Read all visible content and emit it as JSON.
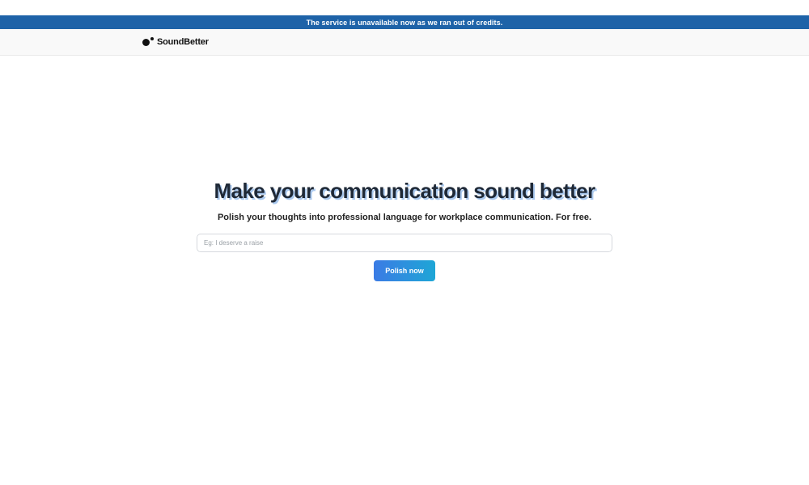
{
  "banner": {
    "message": "The service is unavailable now as we ran out of credits."
  },
  "navbar": {
    "brand_name": "SoundBetter",
    "logo_icon": "two-dots-logo-icon"
  },
  "hero": {
    "title": "Make your communication sound better",
    "subtitle": "Polish your thoughts into professional language for workplace communication. For free."
  },
  "form": {
    "input_value": "",
    "input_placeholder": "Eg: I deserve a raise",
    "submit_label": "Polish now"
  },
  "colors": {
    "banner_bg": "#1e63a8",
    "title_shadow": "#a9c8ee",
    "button_gradient_start": "#3b7be5",
    "button_gradient_end": "#1ea6d6"
  }
}
